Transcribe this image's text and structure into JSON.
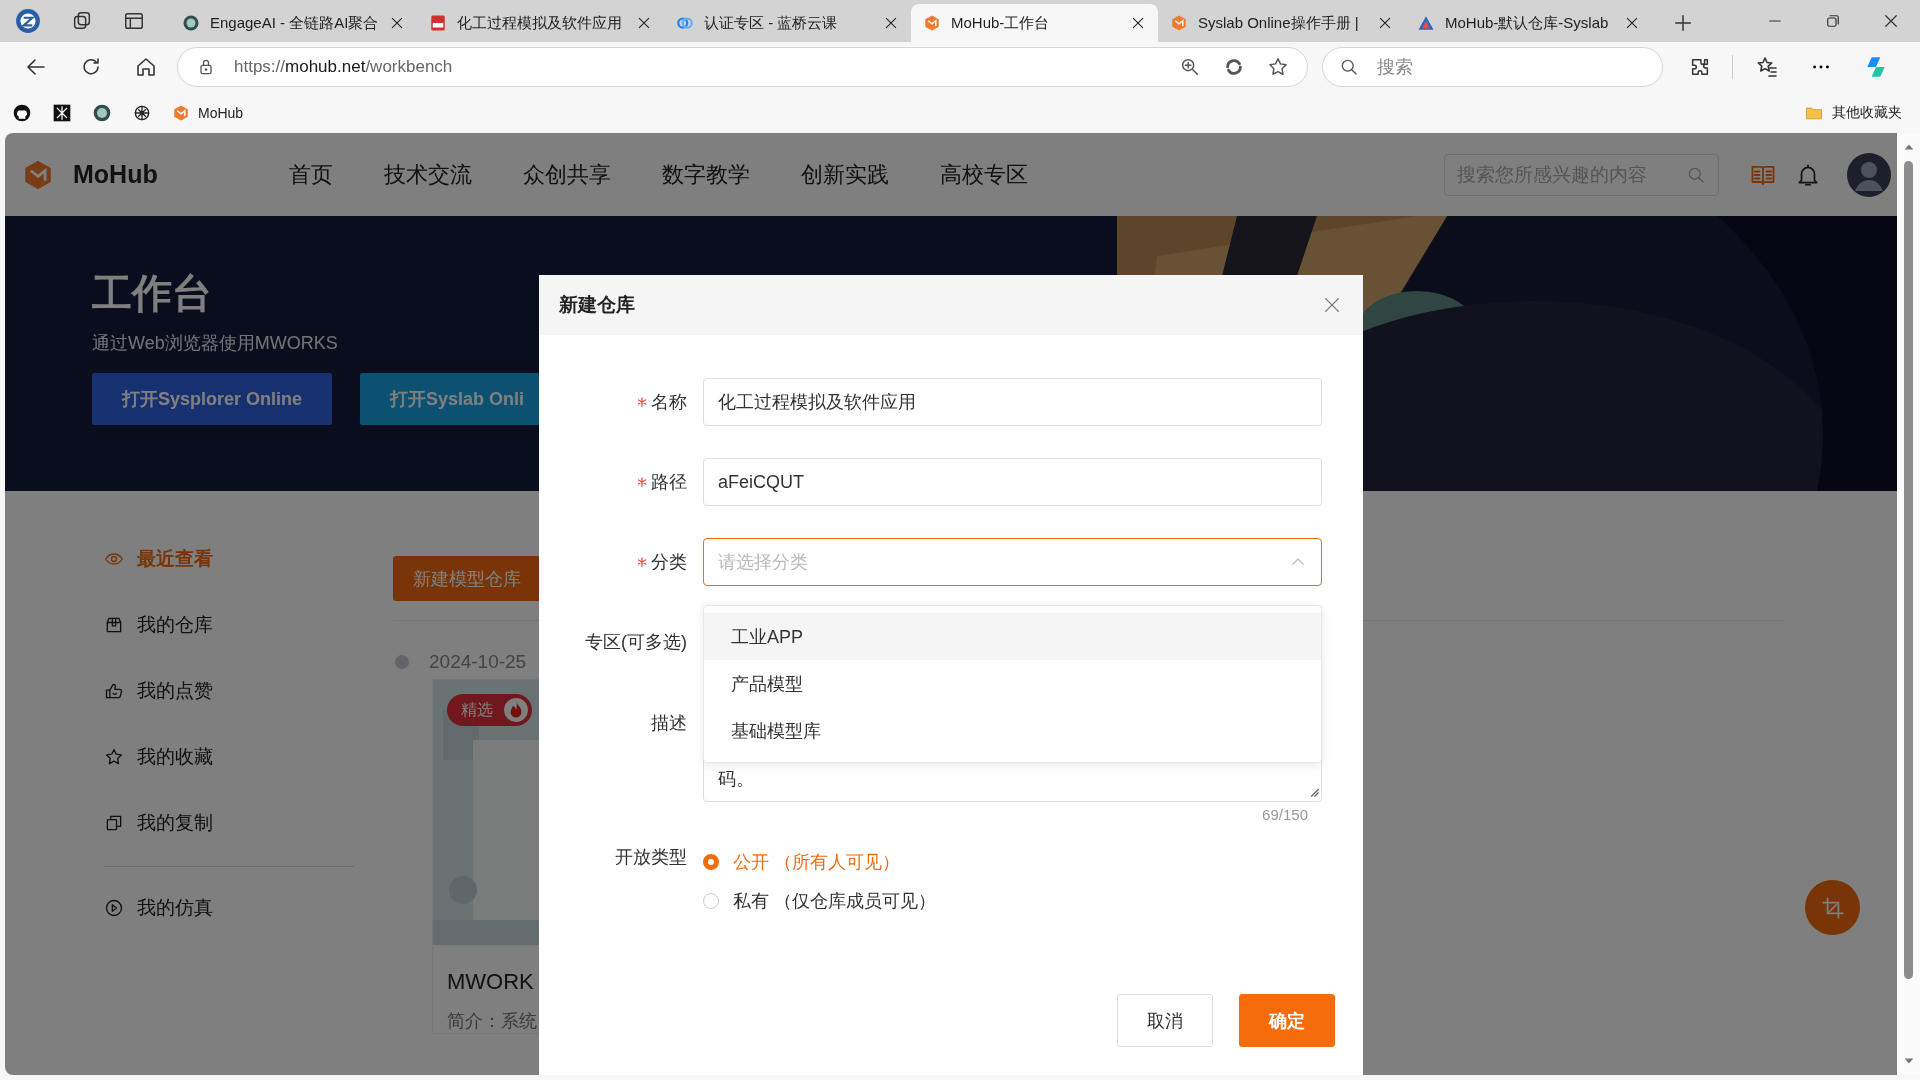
{
  "browser": {
    "tabs": [
      {
        "title": "EngageAI - 全链路AI聚合",
        "selected": false
      },
      {
        "title": "化工过程模拟及软件应用",
        "selected": false
      },
      {
        "title": "认证专区 - 蓝桥云课",
        "selected": false
      },
      {
        "title": "MoHub-工作台",
        "selected": true
      },
      {
        "title": "Syslab Online操作手册 |",
        "selected": false
      },
      {
        "title": "MoHub-默认仓库-Syslab",
        "selected": false
      }
    ],
    "address": {
      "url": "https://**mohub.net**/workbench"
    },
    "search": {
      "placeholder": "搜索"
    },
    "bookmarks": [
      {
        "label": "MoHub"
      }
    ],
    "other_bookmarks": "其他收藏夹"
  },
  "header": {
    "logo": "MoHub",
    "nav": [
      "首页",
      "技术交流",
      "众创共享",
      "数字教学",
      "创新实践",
      "高校专区"
    ],
    "search": {
      "placeholder": "搜索您所感兴趣的内容"
    }
  },
  "banner": {
    "title": "工作台",
    "subtitle": "通过Web浏览器使用MWORKS",
    "buttons": [
      {
        "label": "打开Sysplorer Online",
        "kind": "dark"
      },
      {
        "label": "打开Syslab Onli",
        "kind": "light"
      }
    ]
  },
  "sidebar": {
    "groups": [
      {
        "items": [
          {
            "label": "最近查看",
            "selected": true
          },
          {
            "label": "我的仓库",
            "selected": false
          },
          {
            "label": "我的点赞",
            "selected": false
          },
          {
            "label": "我的收藏",
            "selected": false
          },
          {
            "label": "我的复制",
            "selected": false
          }
        ]
      },
      {
        "items": [
          {
            "label": "我的仿真",
            "selected": false
          }
        ]
      }
    ]
  },
  "content": {
    "new_button": "新建模型仓库",
    "entries": [
      {
        "date": "2024-10-25",
        "card": {
          "badge": "精选",
          "title": "MWORK",
          "summary": "简介：系统"
        }
      }
    ]
  },
  "dialog": {
    "title": "新建仓库",
    "fields": [
      {
        "kind": "input",
        "label": "名称",
        "required": true,
        "value": "化工过程模拟及软件应用"
      },
      {
        "kind": "input",
        "label": "路径",
        "required": true,
        "value": "aFeiCQUT"
      },
      {
        "kind": "select",
        "label": "分类",
        "required": true,
        "placeholder": "请选择分类",
        "expanded": true,
        "options": [
          {
            "label": "工业APP",
            "highlighted": true
          },
          {
            "label": "产品模型",
            "highlighted": false
          },
          {
            "label": "基础模型库",
            "highlighted": false
          }
        ]
      },
      {
        "kind": "multiselect",
        "label": "专区(可多选)"
      },
      {
        "kind": "textarea",
        "label": "描述",
        "value": "码。",
        "counter": "69/150"
      },
      {
        "kind": "radio",
        "label": "开放类型",
        "options": [
          {
            "label": "公开 （所有人可见）",
            "selected": true
          },
          {
            "label": "私有 （仅仓库成员可见）",
            "selected": false
          }
        ]
      }
    ],
    "buttons": [
      {
        "label": "取消",
        "kind": "secondary"
      },
      {
        "label": "确定",
        "kind": "primary"
      }
    ]
  }
}
